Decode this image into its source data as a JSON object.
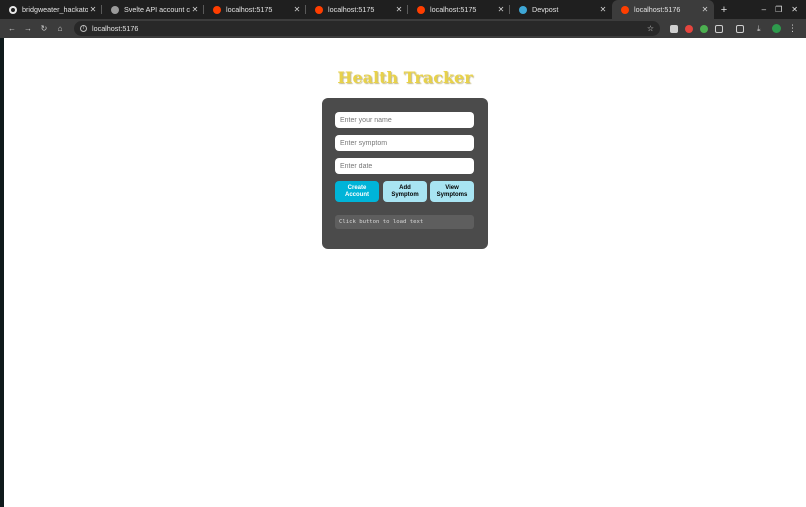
{
  "browser": {
    "tabs": [
      {
        "label": "bridgweater_hackaton/f",
        "icon": "github-icon"
      },
      {
        "label": "Svelte API account creat",
        "icon": "globe-icon"
      },
      {
        "label": "localhost:5175",
        "icon": "svelte-icon"
      },
      {
        "label": "localhost:5175",
        "icon": "svelte-icon"
      },
      {
        "label": "localhost:5175",
        "icon": "svelte-icon"
      },
      {
        "label": "Devpost",
        "icon": "devpost-icon"
      },
      {
        "label": "localhost:5176",
        "icon": "svelte-icon",
        "active": true
      }
    ],
    "address": "localhost:5176"
  },
  "app": {
    "title": "Health Tracker",
    "name_placeholder": "Enter your name",
    "symptom_placeholder": "Enter symptom",
    "date_placeholder": "Enter date",
    "create_account_label": "Create Account",
    "add_symptom_label": "Add Symptom",
    "view_symptoms_label": "View Symptoms",
    "output_text": "Click button to load text"
  },
  "colors": {
    "title": "#e8d24a",
    "card": "#4b4b4b",
    "primary_button": "#00b4d8",
    "secondary_button": "#a8e4f2"
  }
}
